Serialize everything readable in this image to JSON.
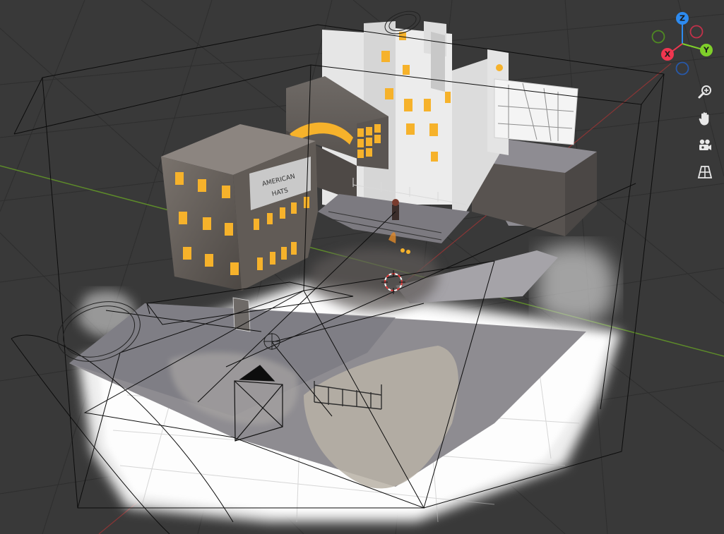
{
  "viewport": {
    "background": "#393939",
    "grid_color": "#2c2c2c",
    "x_axis_color": "#9b3a3a",
    "y_axis_color": "#5d8a2a"
  },
  "gizmo": {
    "axes": [
      {
        "name": "z",
        "label": "Z",
        "color": "#2d8bf0"
      },
      {
        "name": "y",
        "label": "Y",
        "color": "#7fcf2a"
      },
      {
        "name": "x",
        "label": "X",
        "color": "#f0364f"
      },
      {
        "name": "neg-x",
        "label": "",
        "color": "#c2314a"
      },
      {
        "name": "neg-y",
        "label": "",
        "color": "#4f8a22"
      },
      {
        "name": "neg-z",
        "label": "",
        "color": "#2758a8"
      }
    ]
  },
  "nav_buttons": [
    {
      "name": "zoom-icon",
      "title": "Zoom"
    },
    {
      "name": "pan-hand-icon",
      "title": "Move"
    },
    {
      "name": "camera-view-icon",
      "title": "Toggle camera view"
    },
    {
      "name": "perspective-grid-icon",
      "title": "Toggle perspective"
    }
  ],
  "scene": {
    "sign_text_top": "AMERICAN",
    "sign_text_bottom": "HATS",
    "window_color": "#f6b22b",
    "fog_color": "#e9e9e9"
  }
}
